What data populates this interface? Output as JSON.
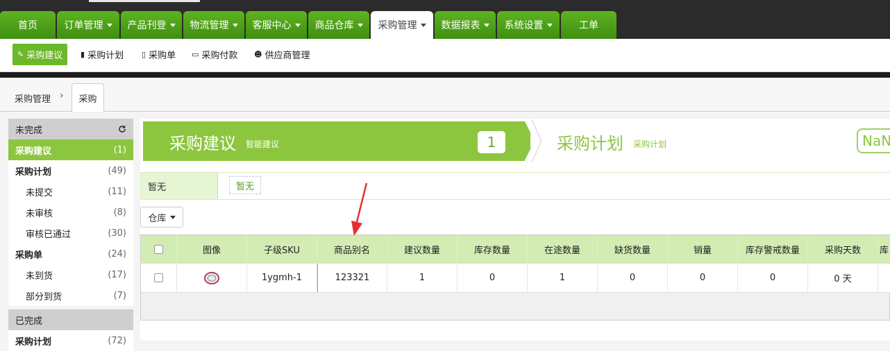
{
  "nav": {
    "items": [
      {
        "label": "首页",
        "caret": false
      },
      {
        "label": "订单管理",
        "caret": true
      },
      {
        "label": "产品刊登",
        "caret": true
      },
      {
        "label": "物流管理",
        "caret": true
      },
      {
        "label": "客服中心",
        "caret": true
      },
      {
        "label": "商品仓库",
        "caret": true
      },
      {
        "label": "采购管理",
        "caret": true,
        "active": true
      },
      {
        "label": "数据报表",
        "caret": true
      },
      {
        "label": "系统设置",
        "caret": true
      },
      {
        "label": "工单",
        "caret": false
      }
    ]
  },
  "subnav": {
    "items": [
      {
        "label": "采购建议",
        "icon": "wand-icon",
        "active": true
      },
      {
        "label": "采购计划",
        "icon": "book-icon"
      },
      {
        "label": "采购单",
        "icon": "file-icon"
      },
      {
        "label": "采购付款",
        "icon": "card-icon"
      },
      {
        "label": "供应商管理",
        "icon": "users-icon"
      }
    ]
  },
  "breadcrumb": {
    "parent": "采购管理",
    "current": "采购"
  },
  "sidebar": {
    "group_incomplete": "未完成",
    "group_complete": "已完成",
    "rows": [
      {
        "label": "采购建议",
        "count": "(1)",
        "kind": "active"
      },
      {
        "label": "采购计划",
        "count": "(49)",
        "kind": "head"
      },
      {
        "label": "未提交",
        "count": "(11)",
        "kind": "sub"
      },
      {
        "label": "未审核",
        "count": "(8)",
        "kind": "sub"
      },
      {
        "label": "审核已通过",
        "count": "(30)",
        "kind": "sub"
      },
      {
        "label": "采购单",
        "count": "(24)",
        "kind": "head"
      },
      {
        "label": "未到货",
        "count": "(17)",
        "kind": "sub"
      },
      {
        "label": "部分到货",
        "count": "(7)",
        "kind": "sub"
      }
    ],
    "partial_row": {
      "label": "采购计划",
      "count": "(72)"
    }
  },
  "steps": {
    "step1": {
      "title": "采购建议",
      "subtitle": "智能建议",
      "badge": "1"
    },
    "step2": {
      "title": "采购计划",
      "subtitle": "采购计划",
      "badge": "NaN"
    }
  },
  "filter": {
    "label": "暂无",
    "tag": "暂无"
  },
  "warehouse_button": {
    "label": "仓库"
  },
  "table": {
    "columns": [
      "",
      "图像",
      "子级SKU",
      "商品别名",
      "建议数量",
      "库存数量",
      "在途数量",
      "缺货数量",
      "销量",
      "库存警戒数量",
      "采购天数",
      "库"
    ],
    "rows": [
      [
        "",
        "",
        "1ygmh-1",
        "123321",
        "1",
        "0",
        "1",
        "0",
        "0",
        "0",
        "0 天",
        ""
      ]
    ]
  },
  "colors": {
    "nav_green": "#4a9e18",
    "accent": "#8cc63f",
    "header_row": "#d2ecb4",
    "arrow": "#e53030"
  }
}
